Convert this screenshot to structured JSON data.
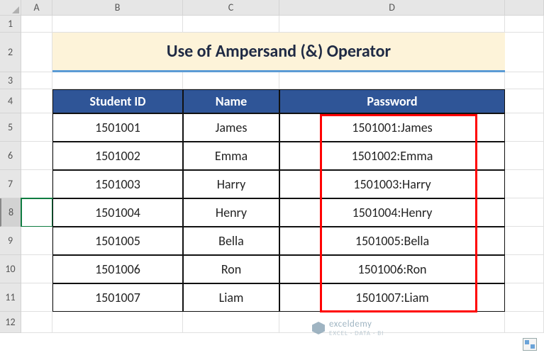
{
  "columns": [
    "A",
    "B",
    "C",
    "D"
  ],
  "rows": [
    "1",
    "2",
    "3",
    "4",
    "5",
    "6",
    "7",
    "8",
    "9",
    "10",
    "11",
    "12"
  ],
  "title": "Use of Ampersand (&) Operator",
  "headers": {
    "b": "Student ID",
    "c": "Name",
    "d": "Password"
  },
  "data": [
    {
      "id": "1501001",
      "name": "James",
      "pw": "1501001:James"
    },
    {
      "id": "1501002",
      "name": "Emma",
      "pw": "1501002:Emma"
    },
    {
      "id": "1501003",
      "name": "Harry",
      "pw": "1501003:Harry"
    },
    {
      "id": "1501004",
      "name": "Henry",
      "pw": "1501004:Henry"
    },
    {
      "id": "1501005",
      "name": "Bella",
      "pw": "1501005:Bella"
    },
    {
      "id": "1501006",
      "name": "Ron",
      "pw": "1501006:Ron"
    },
    {
      "id": "1501007",
      "name": "Liam",
      "pw": "1501007:Liam"
    }
  ],
  "selected_row": "8",
  "watermark": {
    "brand": "exceldemy",
    "sub": "EXCEL · DATA · BI"
  },
  "chart_data": {
    "type": "table",
    "title": "Use of Ampersand (&) Operator",
    "columns": [
      "Student ID",
      "Name",
      "Password"
    ],
    "rows": [
      [
        "1501001",
        "James",
        "1501001:James"
      ],
      [
        "1501002",
        "Emma",
        "1501002:Emma"
      ],
      [
        "1501003",
        "Harry",
        "1501003:Harry"
      ],
      [
        "1501004",
        "Henry",
        "1501004:Henry"
      ],
      [
        "1501005",
        "Bella",
        "1501005:Bella"
      ],
      [
        "1501006",
        "Ron",
        "1501006:Ron"
      ],
      [
        "1501007",
        "Liam",
        "1501007:Liam"
      ]
    ]
  }
}
